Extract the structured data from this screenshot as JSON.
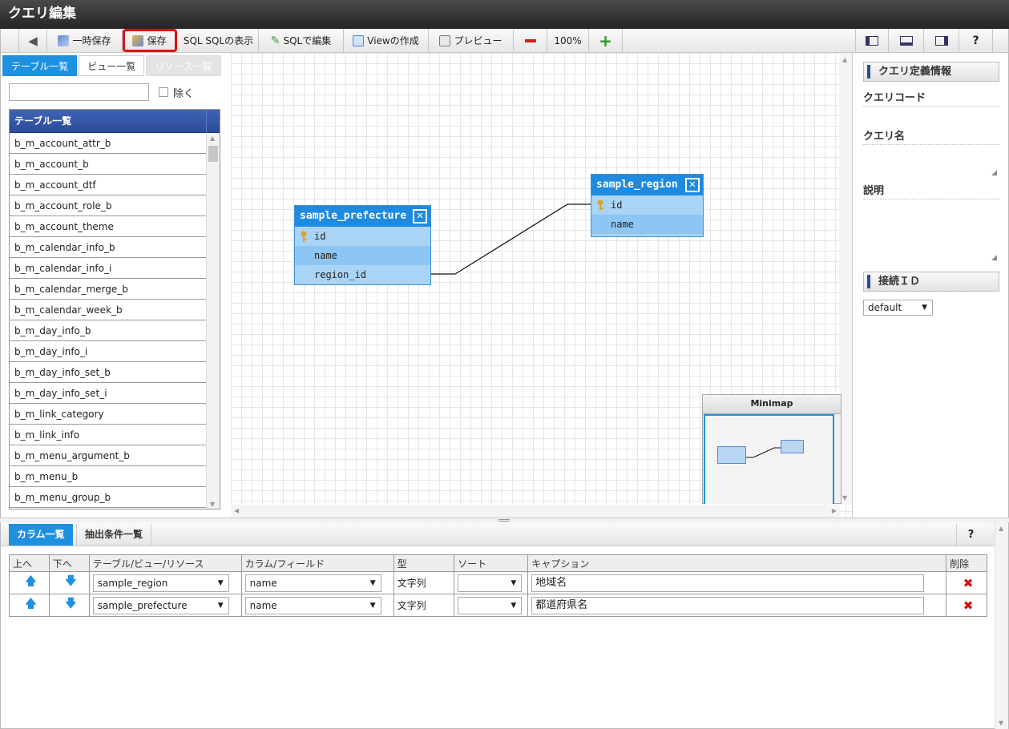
{
  "title": "クエリ編集",
  "toolbar": {
    "back": "",
    "temp_save": "一時保存",
    "save": "保存",
    "show_sql": "SQL SQLの表示",
    "edit_sql": "SQLで編集",
    "create_view": "Viewの作成",
    "preview": "プレビュー",
    "zoom": "100%",
    "help": "?"
  },
  "left": {
    "tabs": [
      "テーブル一覧",
      "ビュー一覧",
      "リソース一覧"
    ],
    "exclude_label": "除く",
    "list_header": "テーブル一覧",
    "items": [
      "b_m_account_attr_b",
      "b_m_account_b",
      "b_m_account_dtf",
      "b_m_account_role_b",
      "b_m_account_theme",
      "b_m_calendar_info_b",
      "b_m_calendar_info_i",
      "b_m_calendar_merge_b",
      "b_m_calendar_week_b",
      "b_m_day_info_b",
      "b_m_day_info_i",
      "b_m_day_info_set_b",
      "b_m_day_info_set_i",
      "b_m_link_category",
      "b_m_link_info",
      "b_m_menu_argument_b",
      "b_m_menu_b",
      "b_m_menu_group_b"
    ]
  },
  "canvas": {
    "entity1": {
      "name": "sample_prefecture",
      "cols": [
        "id",
        "name",
        "region_id"
      ]
    },
    "entity2": {
      "name": "sample_region",
      "cols": [
        "id",
        "name"
      ]
    },
    "minimap_title": "Minimap"
  },
  "right": {
    "section_query": "クエリ定義情報",
    "label_code": "クエリコード",
    "label_name": "クエリ名",
    "label_desc": "説明",
    "section_conn": "接続ＩＤ",
    "conn_value": "default"
  },
  "bottom": {
    "tabs": [
      "カラム一覧",
      "抽出条件一覧"
    ],
    "help": "?",
    "headers": [
      "上へ",
      "下へ",
      "テーブル/ビュー/リソース",
      "カラム/フィールド",
      "型",
      "ソート",
      "キャプション",
      "削除"
    ],
    "rows": [
      {
        "table": "sample_region",
        "column": "name",
        "type": "文字列",
        "sort": "",
        "caption": "地域名"
      },
      {
        "table": "sample_prefecture",
        "column": "name",
        "type": "文字列",
        "sort": "",
        "caption": "都道府県名"
      }
    ]
  }
}
